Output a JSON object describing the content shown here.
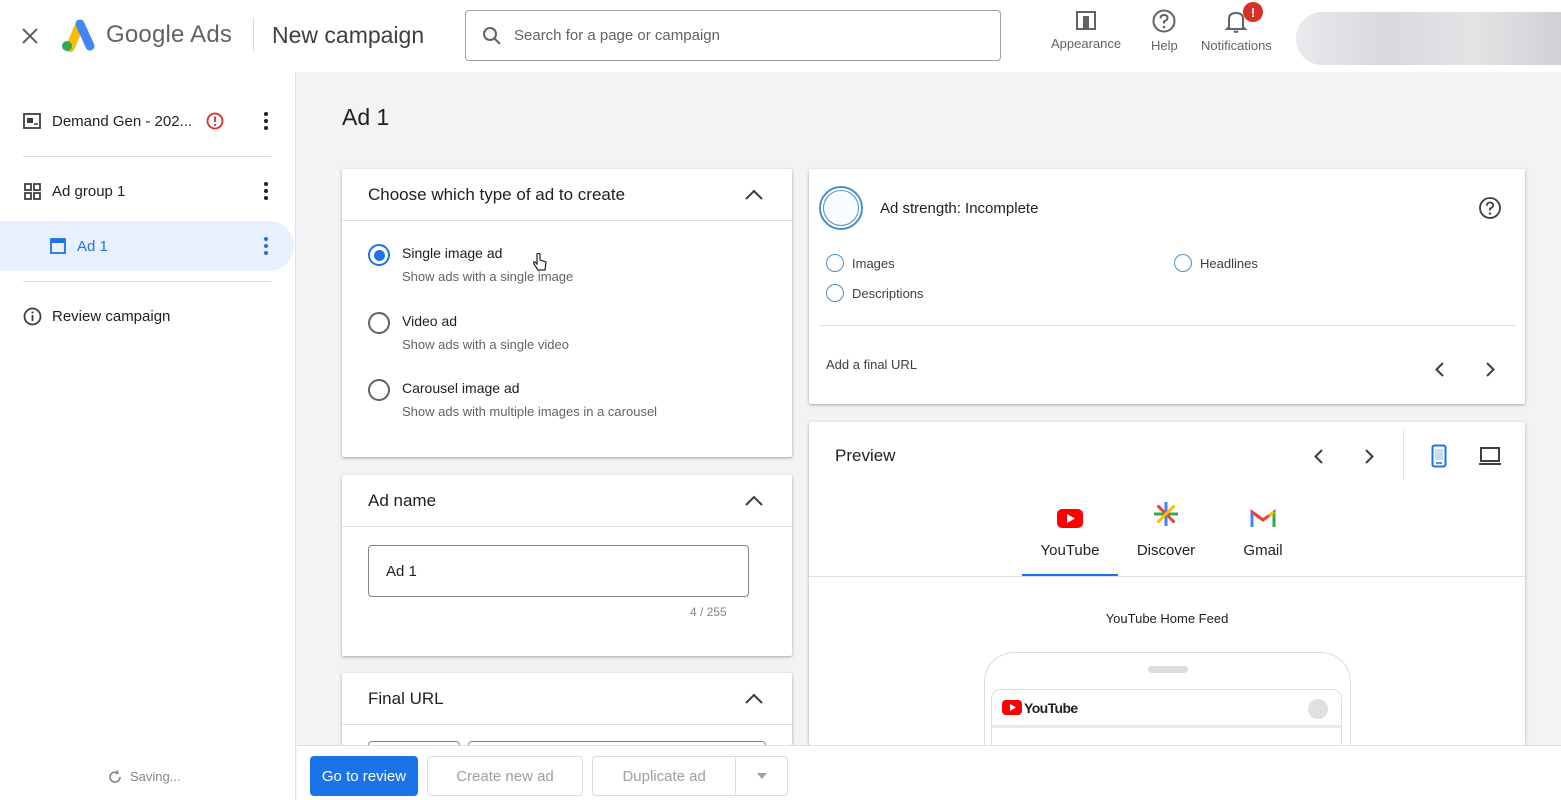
{
  "header": {
    "logo_text": "Google Ads",
    "page_title": "New campaign",
    "search_placeholder": "Search for a page or campaign",
    "actions": {
      "appearance": "Appearance",
      "help": "Help",
      "notifications": "Notifications",
      "notification_badge": "!"
    }
  },
  "sidebar": {
    "campaign": "Demand Gen - 202...",
    "ad_group": "Ad group 1",
    "ad": "Ad 1",
    "review": "Review campaign",
    "status": "Saving..."
  },
  "main": {
    "title": "Ad 1",
    "ad_type": {
      "header": "Choose which type of ad to create",
      "options": [
        {
          "title": "Single image ad",
          "subtitle": "Show ads with a single image",
          "selected": true
        },
        {
          "title": "Video ad",
          "subtitle": "Show ads with a single video",
          "selected": false
        },
        {
          "title": "Carousel image ad",
          "subtitle": "Show ads with multiple images in a carousel",
          "selected": false
        }
      ]
    },
    "ad_name": {
      "header": "Ad name",
      "value": "Ad 1",
      "counter": "4 / 255"
    },
    "final_url": {
      "header": "Final URL"
    }
  },
  "strength": {
    "label": "Ad strength: Incomplete",
    "items": [
      "Images",
      "Headlines",
      "Descriptions"
    ],
    "hint": "Add a final URL"
  },
  "preview": {
    "title": "Preview",
    "channels": [
      "YouTube",
      "Discover",
      "Gmail"
    ],
    "active_channel": "YouTube",
    "feed_label": "YouTube Home Feed",
    "youtube_wordmark": "YouTube"
  },
  "footer": {
    "go_to_review": "Go to review",
    "create_new_ad": "Create new ad",
    "duplicate_ad": "Duplicate ad"
  },
  "colors": {
    "primary": "#1a73e8",
    "alert": "#d93025",
    "youtube_red": "#ff0000"
  }
}
